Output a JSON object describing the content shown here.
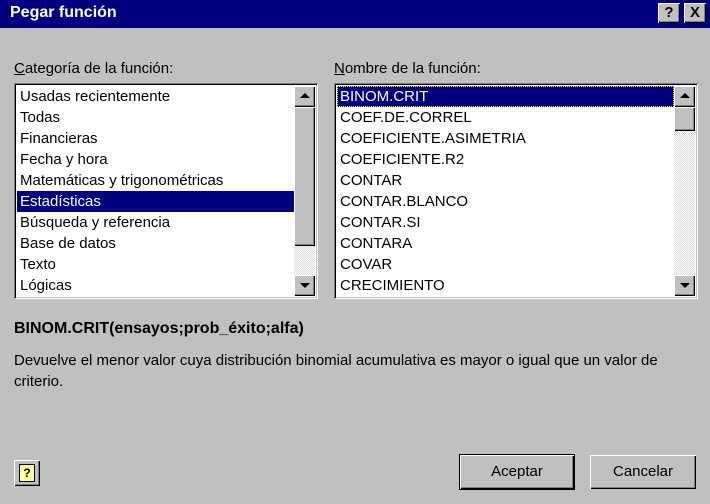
{
  "window": {
    "title": "Pegar función",
    "help_label": "?",
    "close_label": "X"
  },
  "category": {
    "label_prefix": "C",
    "label_rest": "ategoría de la función:",
    "items": [
      {
        "label": "Usadas recientemente",
        "selected": false
      },
      {
        "label": "Todas",
        "selected": false
      },
      {
        "label": "Financieras",
        "selected": false
      },
      {
        "label": "Fecha y hora",
        "selected": false
      },
      {
        "label": "Matemáticas y trigonométricas",
        "selected": false
      },
      {
        "label": "Estadísticas",
        "selected": true
      },
      {
        "label": "Búsqueda y referencia",
        "selected": false
      },
      {
        "label": "Base de datos",
        "selected": false
      },
      {
        "label": "Texto",
        "selected": false
      },
      {
        "label": "Lógicas",
        "selected": false
      }
    ]
  },
  "functions": {
    "label_prefix": "N",
    "label_rest": "ombre de la función:",
    "items": [
      {
        "label": "BINOM.CRIT",
        "selected": true
      },
      {
        "label": "COEF.DE.CORREL",
        "selected": false
      },
      {
        "label": "COEFICIENTE.ASIMETRIA",
        "selected": false
      },
      {
        "label": "COEFICIENTE.R2",
        "selected": false
      },
      {
        "label": "CONTAR",
        "selected": false
      },
      {
        "label": "CONTAR.BLANCO",
        "selected": false
      },
      {
        "label": "CONTAR.SI",
        "selected": false
      },
      {
        "label": "CONTARA",
        "selected": false
      },
      {
        "label": "COVAR",
        "selected": false
      },
      {
        "label": "CRECIMIENTO",
        "selected": false
      }
    ]
  },
  "signature": "BINOM.CRIT(ensayos;prob_éxito;alfa)",
  "description": "Devuelve el menor valor cuya distribución binomial acumulativa es mayor o igual que un valor de criterio.",
  "office_help_glyph": "?",
  "buttons": {
    "ok": "Aceptar",
    "cancel": "Cancelar"
  }
}
